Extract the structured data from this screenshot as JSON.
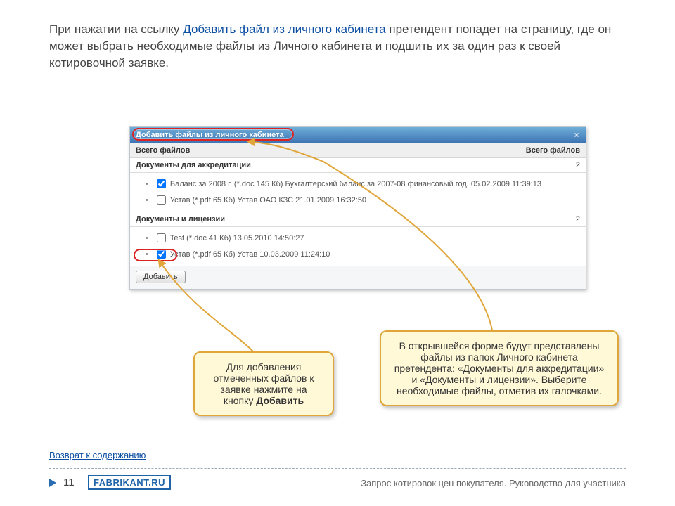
{
  "intro": {
    "pre": "При нажатии на ссылку ",
    "link": "Добавить файл из личного кабинета",
    "post": " претендент попадет на страницу, где он может выбрать необходимые файлы из Личного кабинета и подшить их за один раз к своей котировочной заявке."
  },
  "dialog": {
    "title": "Добавить файлы из личного кабинета",
    "headerLeft": "Всего файлов",
    "headerRight": "Всего файлов",
    "sections": [
      {
        "name": "Документы для аккредитации",
        "count": "2",
        "files": [
          {
            "checked": true,
            "label": "Баланс за 2008 г. (*.doc 145 Кб) Бухгалтерский баланс за 2007-08 финансовый год. 05.02.2009 11:39:13"
          },
          {
            "checked": false,
            "label": "Устав (*.pdf 65 Кб) Устав ОАО КЗС 21.01.2009 16:32:50"
          }
        ]
      },
      {
        "name": "Документы и лицензии",
        "count": "2",
        "files": [
          {
            "checked": false,
            "label": "Test (*.doc 41 Кб) 13.05.2010 14:50:27"
          },
          {
            "checked": true,
            "label": "Устав (*.pdf 65 Кб) Устав 10.03.2009 11:24:10"
          }
        ]
      }
    ],
    "addButton": "Добавить"
  },
  "notes": {
    "left": {
      "pre": "Для добавления отмеченных файлов к заявке нажмите на кнопку ",
      "bold": "Добавить"
    },
    "right": "В открывшейся форме будут представлены файлы из папок Личного кабинета претендента: «Документы для аккредитации» и «Документы и лицензии». Выберите необходимые файлы, отметив их галочками."
  },
  "footer": {
    "returnLink": "Возврат к содержанию",
    "page": "11",
    "brand": "FABRIKANT",
    "brandSuffix": ".RU",
    "caption": "Запрос котировок цен покупателя. Руководство для участника"
  }
}
